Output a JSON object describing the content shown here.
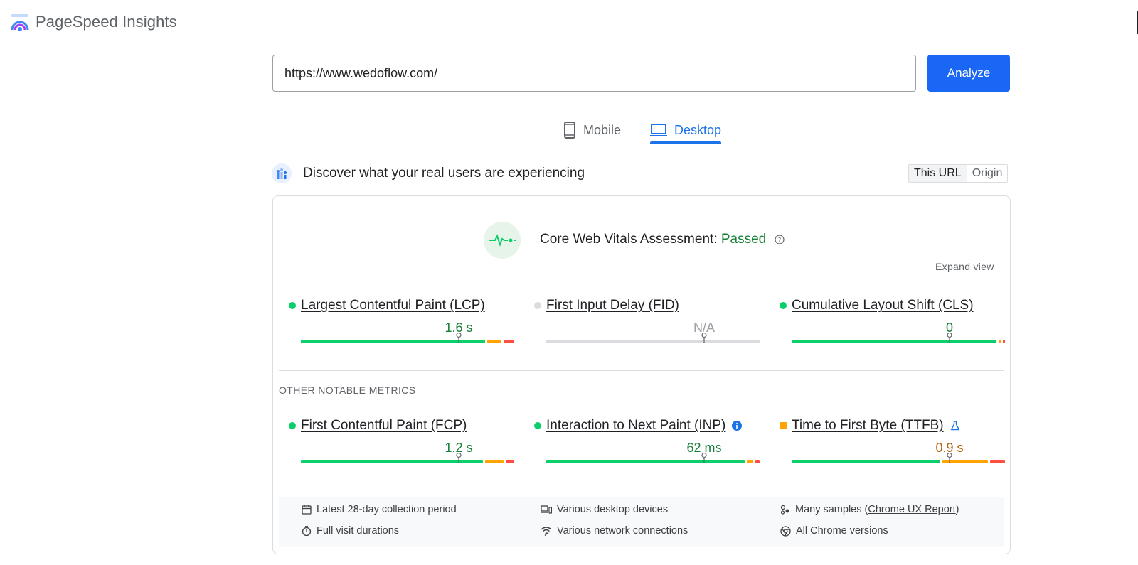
{
  "header": {
    "brand_name": "PageSpeed Insights",
    "logo_icon": "pagespeed-logo-icon"
  },
  "search": {
    "url_value": "https://www.wedoflow.com/",
    "analyze_label": "Analyze"
  },
  "tabs": [
    {
      "label": "Mobile",
      "icon": "phone-icon",
      "selected": false
    },
    {
      "label": "Desktop",
      "icon": "laptop-icon",
      "selected": true
    }
  ],
  "field_data": {
    "title": "Discover what your real users are experiencing",
    "toggle": {
      "this_url": "This URL",
      "origin": "Origin",
      "selected": "This URL"
    }
  },
  "assessment": {
    "label": "Core Web Vitals Assessment: ",
    "status": "Passed",
    "expand_label": "Expand view"
  },
  "core_metrics": [
    {
      "name": "Largest Contentful Paint (LCP)",
      "value": "1.6 s",
      "rating": "good",
      "marker_fraction": 0.75
    },
    {
      "name": "First Input Delay (FID)",
      "value": "N/A",
      "rating": "na",
      "marker_fraction": 0.75
    },
    {
      "name": "Cumulative Layout Shift (CLS)",
      "value": "0",
      "rating": "good",
      "marker_fraction": 0.75
    }
  ],
  "other_metrics_label": "OTHER NOTABLE METRICS",
  "other_metrics": [
    {
      "name": "First Contentful Paint (FCP)",
      "value": "1.2 s",
      "rating": "good",
      "marker_fraction": 0.75
    },
    {
      "name": "Interaction to Next Paint (INP)",
      "value": "62 ms",
      "rating": "good",
      "marker_fraction": 0.75
    },
    {
      "name": "Time to First Byte (TTFB)",
      "value": "0.9 s",
      "rating": "needs-improvement",
      "marker_fraction": 0.75
    }
  ],
  "distributions": {
    "lcp": {
      "good": 0.88,
      "needs_improvement": 0.07,
      "poor": 0.05
    },
    "fid": {
      "good": 0.0,
      "needs_improvement": 0.0,
      "poor": 0.0
    },
    "cls": {
      "good": 0.98,
      "needs_improvement": 0.01,
      "poor": 0.01
    },
    "fcp": {
      "good": 0.87,
      "needs_improvement": 0.09,
      "poor": 0.04
    },
    "inp": {
      "good": 0.95,
      "needs_improvement": 0.03,
      "poor": 0.02
    },
    "ttfb": {
      "good": 0.71,
      "needs_improvement": 0.22,
      "poor": 0.07
    }
  },
  "info": {
    "collection_period": "Latest 28-day collection period",
    "devices": "Various desktop devices",
    "samples_prefix": "Many samples (",
    "samples_link": "Chrome UX Report",
    "samples_suffix": ")",
    "visit_durations": "Full visit durations",
    "network": "Various network connections",
    "chrome_versions": "All Chrome versions"
  },
  "colors": {
    "accent": "#1a73e8",
    "good": "#0cce6b",
    "needs_improvement": "#ffa400",
    "poor": "#ff4e42",
    "na": "#dadce0"
  }
}
